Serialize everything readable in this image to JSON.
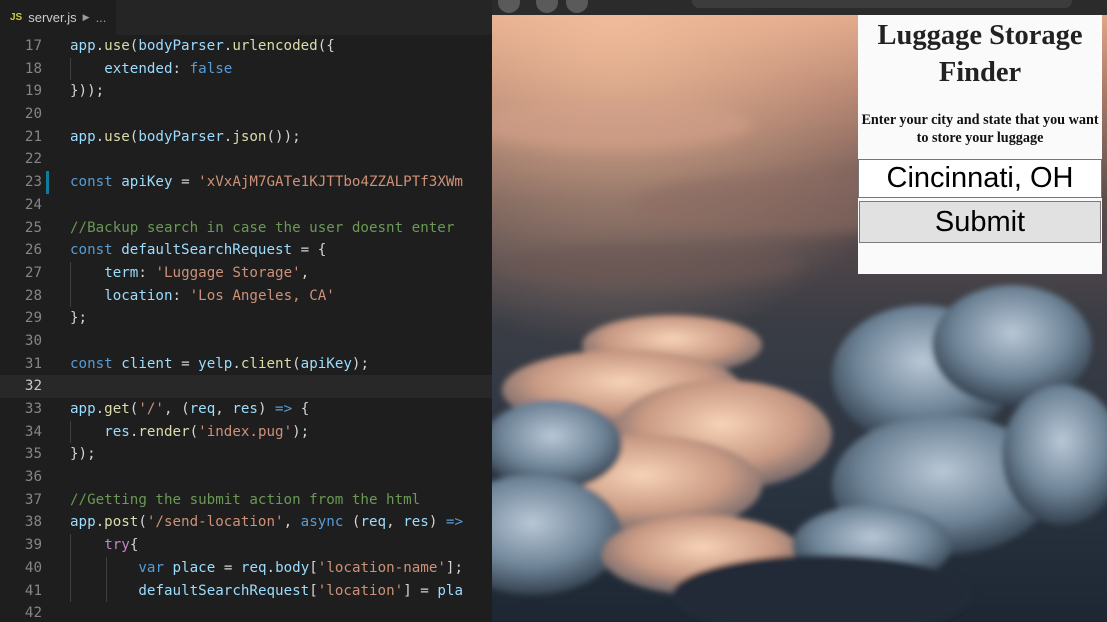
{
  "editor": {
    "tab": {
      "icon_label": "JS",
      "filename": "server.js",
      "breadcrumb_more": "..."
    },
    "lines": [
      {
        "num": "17",
        "code": "app.use(bodyParser.urlencoded({"
      },
      {
        "num": "18",
        "code": "    extended: false"
      },
      {
        "num": "19",
        "code": "}));"
      },
      {
        "num": "20",
        "code": ""
      },
      {
        "num": "21",
        "code": "app.use(bodyParser.json());"
      },
      {
        "num": "22",
        "code": ""
      },
      {
        "num": "23",
        "code": "const apiKey = 'xVxAjM7GATe1KJTTbo4ZZALPTf3XWm"
      },
      {
        "num": "24",
        "code": ""
      },
      {
        "num": "25",
        "code": "//Backup search in case the user doesnt enter"
      },
      {
        "num": "26",
        "code": "const defaultSearchRequest = {"
      },
      {
        "num": "27",
        "code": "    term: 'Luggage Storage',"
      },
      {
        "num": "28",
        "code": "    location: 'Los Angeles, CA'"
      },
      {
        "num": "29",
        "code": "};"
      },
      {
        "num": "30",
        "code": ""
      },
      {
        "num": "31",
        "code": "const client = yelp.client(apiKey);"
      },
      {
        "num": "32",
        "code": ""
      },
      {
        "num": "33",
        "code": "app.get('/', (req, res) => {"
      },
      {
        "num": "34",
        "code": "    res.render('index.pug');"
      },
      {
        "num": "35",
        "code": "});"
      },
      {
        "num": "36",
        "code": ""
      },
      {
        "num": "37",
        "code": "//Getting the submit action from the html"
      },
      {
        "num": "38",
        "code": "app.post('/send-location', async (req, res) =>"
      },
      {
        "num": "39",
        "code": "    try{"
      },
      {
        "num": "40",
        "code": "        var place = req.body['location-name'];"
      },
      {
        "num": "41",
        "code": "        defaultSearchRequest['location'] = pla"
      },
      {
        "num": "42",
        "code": ""
      }
    ]
  },
  "browser": {
    "panel": {
      "title": "Luggage Storage Finder",
      "instructions": "Enter your city and state that you want to store your luggage",
      "location_value": "Cincinnati, OH",
      "submit_label": "Submit"
    }
  },
  "colors": {
    "editor_bg": "#1e1e1e",
    "keyword": "#569cd6",
    "string": "#ce9178",
    "comment": "#6a9955",
    "function": "#dcdcaa",
    "variable": "#9cdcfe"
  }
}
